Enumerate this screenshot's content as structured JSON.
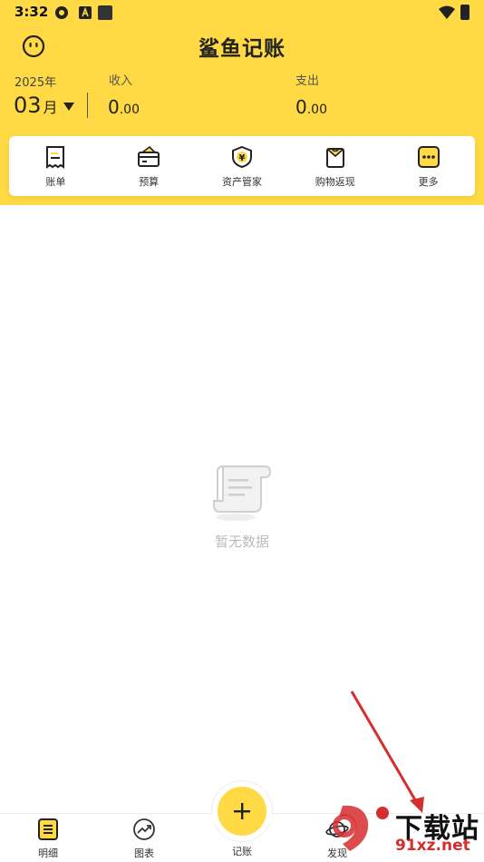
{
  "status_bar": {
    "time": "3:32"
  },
  "header": {
    "title": "鲨鱼记账",
    "year": "2025年",
    "month_number": "03",
    "month_unit": "月",
    "income_label": "收入",
    "income_int": "0",
    "income_dec": ".00",
    "expense_label": "支出",
    "expense_int": "0",
    "expense_dec": ".00"
  },
  "quick_actions": [
    {
      "label": "账单",
      "icon": "bill-icon"
    },
    {
      "label": "预算",
      "icon": "budget-icon"
    },
    {
      "label": "资产管家",
      "icon": "asset-shield-icon"
    },
    {
      "label": "购物返现",
      "icon": "shopping-bag-icon"
    },
    {
      "label": "更多",
      "icon": "more-icon"
    }
  ],
  "empty_state": {
    "text": "暂无数据"
  },
  "tabbar": {
    "tabs": [
      {
        "label": "明细",
        "icon": "detail-list-icon"
      },
      {
        "label": "图表",
        "icon": "chart-trend-icon"
      },
      {
        "label": "记账",
        "icon": "plus-icon"
      },
      {
        "label": "发现",
        "icon": "planet-icon"
      }
    ]
  },
  "watermark": {
    "line1": "下载站",
    "line2": "91xz.net"
  },
  "colors": {
    "brand_yellow": "#FFDA44",
    "arrow_red": "#d62d2d"
  }
}
